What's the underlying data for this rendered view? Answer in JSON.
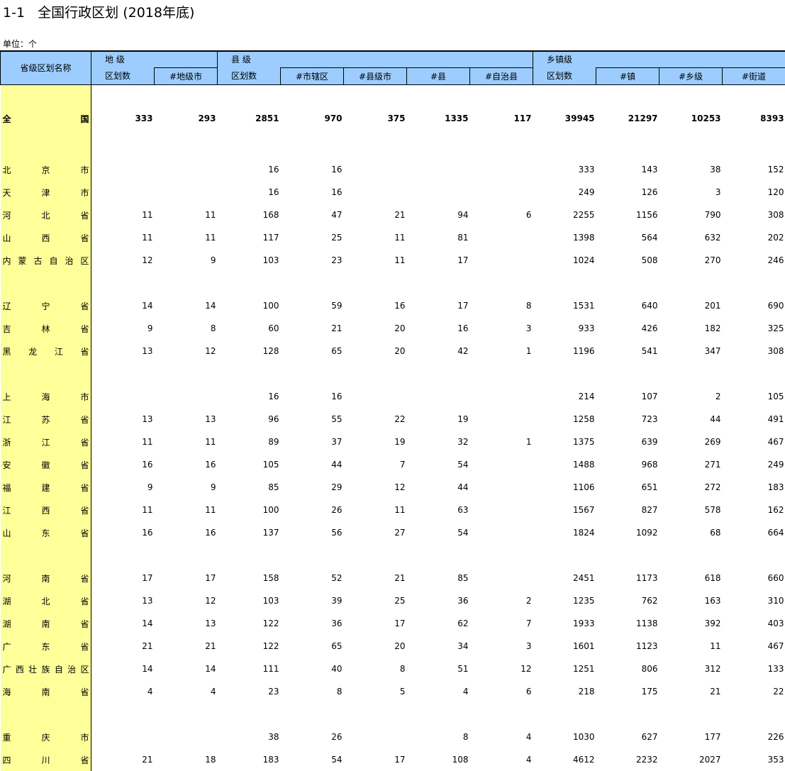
{
  "title": "1-1   全国行政区划 (2018年底)",
  "unit": "单位：个",
  "header": {
    "name_col": "省级区划名称",
    "groups": [
      "地 级",
      "县 级",
      "乡镇级"
    ],
    "pref": [
      "区划数",
      "#地级市"
    ],
    "county": [
      "区划数",
      "#市辖区",
      "#县级市",
      "#县",
      "#自治县"
    ],
    "town": [
      "区划数",
      "#镇",
      "#乡级",
      "#街道"
    ]
  },
  "rows": [
    {
      "type": "gap"
    },
    {
      "type": "total",
      "name": "全国",
      "v": [
        "333",
        "293",
        "2851",
        "970",
        "375",
        "1335",
        "117",
        "39945",
        "21297",
        "10253",
        "8393"
      ]
    },
    {
      "type": "spacer"
    },
    {
      "name": "北京市",
      "v": [
        "",
        "",
        "16",
        "16",
        "",
        "",
        "",
        "333",
        "143",
        "38",
        "152"
      ]
    },
    {
      "name": "天津市",
      "v": [
        "",
        "",
        "16",
        "16",
        "",
        "",
        "",
        "249",
        "126",
        "3",
        "120"
      ]
    },
    {
      "name": "河北省",
      "v": [
        "11",
        "11",
        "168",
        "47",
        "21",
        "94",
        "6",
        "2255",
        "1156",
        "790",
        "308"
      ]
    },
    {
      "name": "山西省",
      "v": [
        "11",
        "11",
        "117",
        "25",
        "11",
        "81",
        "",
        "1398",
        "564",
        "632",
        "202"
      ]
    },
    {
      "name": "内蒙古自治区",
      "v": [
        "12",
        "9",
        "103",
        "23",
        "11",
        "17",
        "",
        "1024",
        "508",
        "270",
        "246"
      ]
    },
    {
      "type": "spacer"
    },
    {
      "name": "辽宁省",
      "v": [
        "14",
        "14",
        "100",
        "59",
        "16",
        "17",
        "8",
        "1531",
        "640",
        "201",
        "690"
      ]
    },
    {
      "name": "吉林省",
      "v": [
        "9",
        "8",
        "60",
        "21",
        "20",
        "16",
        "3",
        "933",
        "426",
        "182",
        "325"
      ]
    },
    {
      "name": "黑龙江省",
      "v": [
        "13",
        "12",
        "128",
        "65",
        "20",
        "42",
        "1",
        "1196",
        "541",
        "347",
        "308"
      ]
    },
    {
      "type": "spacer"
    },
    {
      "name": "上海市",
      "v": [
        "",
        "",
        "16",
        "16",
        "",
        "",
        "",
        "214",
        "107",
        "2",
        "105"
      ]
    },
    {
      "name": "江苏省",
      "v": [
        "13",
        "13",
        "96",
        "55",
        "22",
        "19",
        "",
        "1258",
        "723",
        "44",
        "491"
      ]
    },
    {
      "name": "浙江省",
      "v": [
        "11",
        "11",
        "89",
        "37",
        "19",
        "32",
        "1",
        "1375",
        "639",
        "269",
        "467"
      ]
    },
    {
      "name": "安徽省",
      "v": [
        "16",
        "16",
        "105",
        "44",
        "7",
        "54",
        "",
        "1488",
        "968",
        "271",
        "249"
      ]
    },
    {
      "name": "福建省",
      "v": [
        "9",
        "9",
        "85",
        "29",
        "12",
        "44",
        "",
        "1106",
        "651",
        "272",
        "183"
      ]
    },
    {
      "name": "江西省",
      "v": [
        "11",
        "11",
        "100",
        "26",
        "11",
        "63",
        "",
        "1567",
        "827",
        "578",
        "162"
      ]
    },
    {
      "name": "山东省",
      "v": [
        "16",
        "16",
        "137",
        "56",
        "27",
        "54",
        "",
        "1824",
        "1092",
        "68",
        "664"
      ]
    },
    {
      "type": "spacer"
    },
    {
      "name": "河南省",
      "v": [
        "17",
        "17",
        "158",
        "52",
        "21",
        "85",
        "",
        "2451",
        "1173",
        "618",
        "660"
      ]
    },
    {
      "name": "湖北省",
      "v": [
        "13",
        "12",
        "103",
        "39",
        "25",
        "36",
        "2",
        "1235",
        "762",
        "163",
        "310"
      ]
    },
    {
      "name": "湖南省",
      "v": [
        "14",
        "13",
        "122",
        "36",
        "17",
        "62",
        "7",
        "1933",
        "1138",
        "392",
        "403"
      ]
    },
    {
      "name": "广东省",
      "v": [
        "21",
        "21",
        "122",
        "65",
        "20",
        "34",
        "3",
        "1601",
        "1123",
        "11",
        "467"
      ]
    },
    {
      "name": "广西壮族自治区",
      "v": [
        "14",
        "14",
        "111",
        "40",
        "8",
        "51",
        "12",
        "1251",
        "806",
        "312",
        "133"
      ]
    },
    {
      "name": "海南省",
      "v": [
        "4",
        "4",
        "23",
        "8",
        "5",
        "4",
        "6",
        "218",
        "175",
        "21",
        "22"
      ]
    },
    {
      "type": "spacer"
    },
    {
      "name": "重庆市",
      "v": [
        "",
        "",
        "38",
        "26",
        "",
        "8",
        "4",
        "1030",
        "627",
        "177",
        "226"
      ]
    },
    {
      "name": "四川省",
      "v": [
        "21",
        "18",
        "183",
        "54",
        "17",
        "108",
        "4",
        "4612",
        "2232",
        "2027",
        "353"
      ]
    }
  ]
}
